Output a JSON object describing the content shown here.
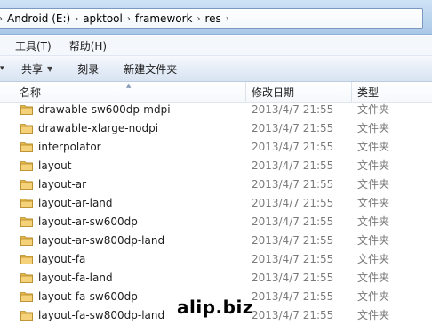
{
  "address_bar": {
    "crumbs": [
      "Android (E:)",
      "apktool",
      "framework",
      "res"
    ]
  },
  "menu": {
    "items": [
      "工具(T)",
      "帮助(H)"
    ]
  },
  "toolbar": {
    "share_label": "共享",
    "burn_label": "刻录",
    "new_folder_label": "新建文件夹"
  },
  "columns": {
    "name": "名称",
    "date": "修改日期",
    "type": "类型"
  },
  "files": [
    {
      "name": "drawable-sw600dp-mdpi",
      "date": "2013/4/7 21:55",
      "type": "文件夹"
    },
    {
      "name": "drawable-xlarge-nodpi",
      "date": "2013/4/7 21:55",
      "type": "文件夹"
    },
    {
      "name": "interpolator",
      "date": "2013/4/7 21:55",
      "type": "文件夹"
    },
    {
      "name": "layout",
      "date": "2013/4/7 21:55",
      "type": "文件夹"
    },
    {
      "name": "layout-ar",
      "date": "2013/4/7 21:55",
      "type": "文件夹"
    },
    {
      "name": "layout-ar-land",
      "date": "2013/4/7 21:55",
      "type": "文件夹"
    },
    {
      "name": "layout-ar-sw600dp",
      "date": "2013/4/7 21:55",
      "type": "文件夹"
    },
    {
      "name": "layout-ar-sw800dp-land",
      "date": "2013/4/7 21:55",
      "type": "文件夹"
    },
    {
      "name": "layout-fa",
      "date": "2013/4/7 21:55",
      "type": "文件夹"
    },
    {
      "name": "layout-fa-land",
      "date": "2013/4/7 21:55",
      "type": "文件夹"
    },
    {
      "name": "layout-fa-sw600dp",
      "date": "2013/4/7 21:55",
      "type": "文件夹"
    },
    {
      "name": "layout-fa-sw800dp-land",
      "date": "2013/4/7 21:55",
      "type": "文件夹"
    }
  ],
  "watermark": "alip.biz",
  "colors": {
    "folder": "#e8b84a",
    "address_bg": "#b9d4ee",
    "muted_text": "#7a7a7a"
  }
}
